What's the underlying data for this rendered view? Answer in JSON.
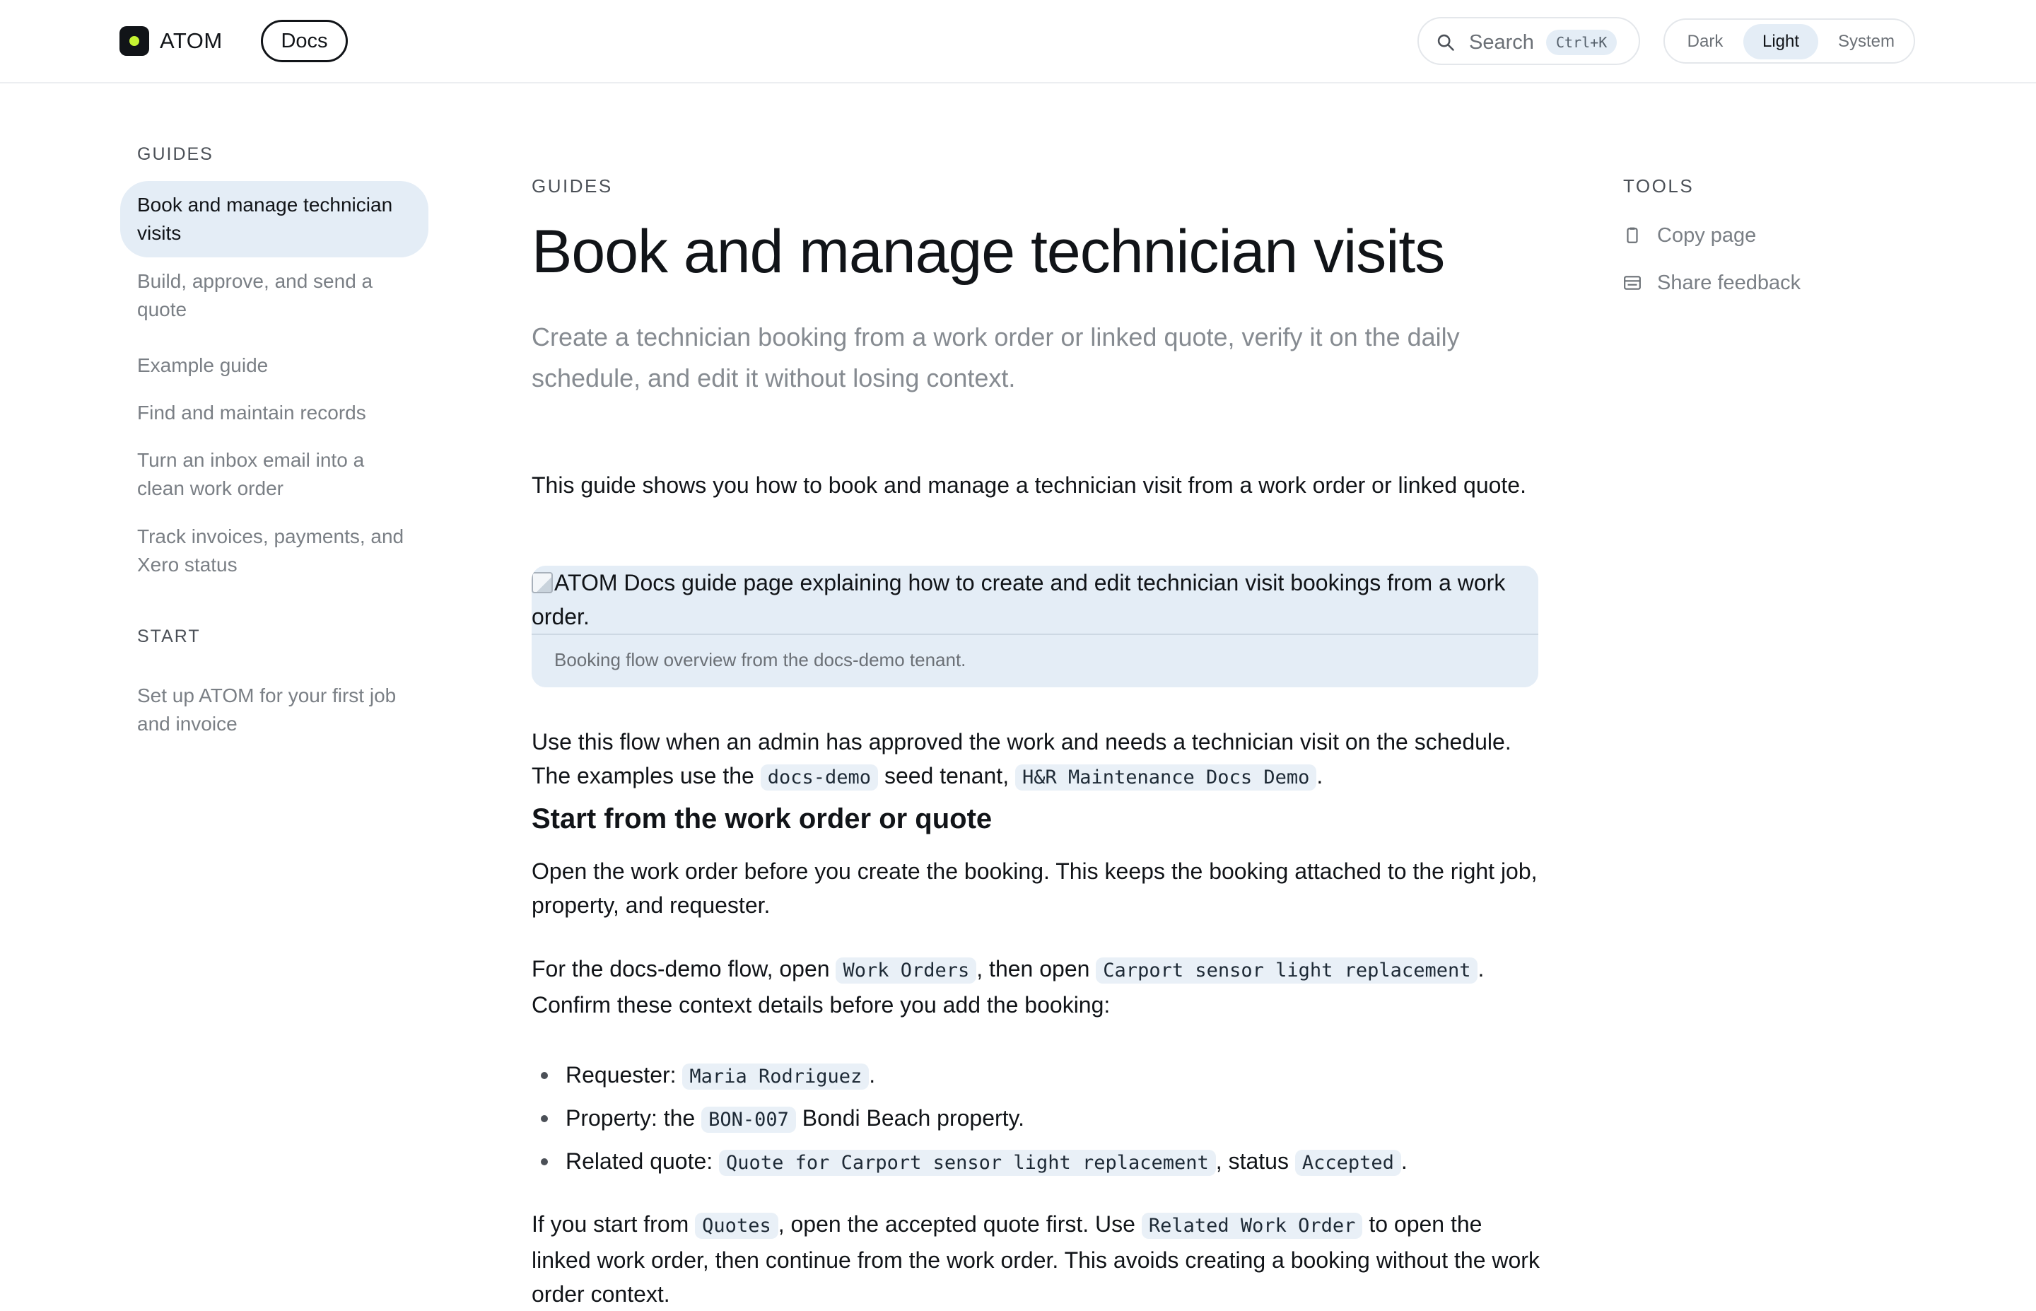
{
  "header": {
    "brand": "ATOM",
    "docs_label": "Docs",
    "search": {
      "label": "Search",
      "shortcut": "Ctrl+K"
    },
    "theme": {
      "options": [
        "Dark",
        "Light",
        "System"
      ],
      "selected": "Light"
    }
  },
  "sidebar": {
    "sections": [
      {
        "heading": "GUIDES",
        "items": [
          {
            "label": "Book and manage technician visits",
            "active": true
          },
          {
            "label": "Build, approve, and send a quote"
          },
          {
            "label": "Example guide"
          },
          {
            "label": "Find and maintain records"
          },
          {
            "label": "Turn an inbox email into a clean work order"
          },
          {
            "label": "Track invoices, payments, and Xero status"
          }
        ]
      },
      {
        "heading": "START",
        "items": [
          {
            "label": "Set up ATOM for your first job and invoice"
          }
        ]
      }
    ]
  },
  "main": {
    "eyebrow": "GUIDES",
    "title": "Book and manage technician visits",
    "lede": "Create a technician booking from a work order or linked quote, verify it on the daily schedule, and edit it without losing context.",
    "intro": "This guide shows you how to book and manage a technician visit from a work order or linked quote.",
    "figure": {
      "alt": "ATOM Docs guide page explaining how to create and edit technician visit bookings from a work order.",
      "caption": "Booking flow overview from the docs-demo tenant."
    },
    "p2": {
      "a": "Use this flow when an admin has approved the work and needs a technician visit on the schedule. The examples use the",
      "code1": "docs-demo",
      "b": "seed tenant,",
      "code2": "H&R Maintenance Docs Demo",
      "c": "."
    },
    "section_heading": "Start from the work order or quote",
    "p3": "Open the work order before you create the booking. This keeps the booking attached to the right job, property, and requester.",
    "p4": {
      "a": "For the docs-demo flow, open",
      "code1": "Work Orders",
      "b": ", then open",
      "code2": "Carport sensor light replacement",
      "c": ". Confirm these context details before you add the booking:"
    },
    "bullets": {
      "requester": {
        "label": "Requester:",
        "code": "Maria Rodriguez",
        "end": "."
      },
      "property": {
        "label": "Property: the",
        "code": "BON-007",
        "end": "Bondi Beach property."
      },
      "quote": {
        "label": "Related quote:",
        "code": "Quote for Carport sensor light replacement",
        "mid": ", status",
        "code2": "Accepted",
        "end": "."
      }
    },
    "p5": {
      "a": "If you start from",
      "code1": "Quotes",
      "b": ", open the accepted quote first. Use",
      "code2": "Related Work Order",
      "c": "to open the linked work order, then continue from the work order. This avoids creating a booking without the work order context."
    }
  },
  "tools": {
    "heading": "TOOLS",
    "copy_page": "Copy page",
    "share_feedback": "Share feedback"
  }
}
